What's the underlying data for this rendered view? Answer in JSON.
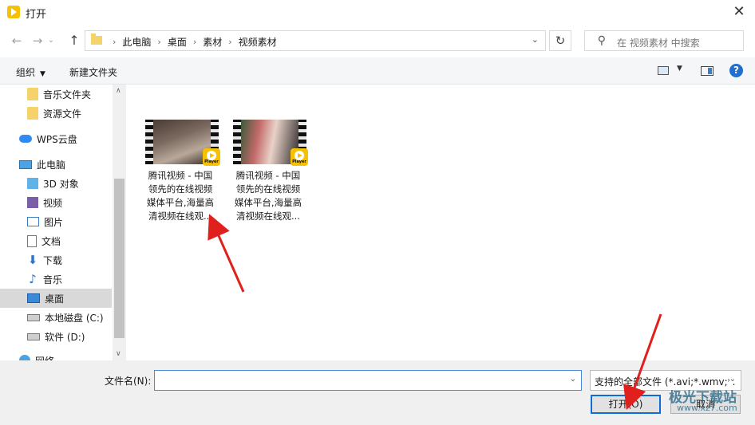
{
  "window": {
    "title": "打开",
    "close_glyph": "✕"
  },
  "nav": {
    "back_glyph": "←",
    "forward_glyph": "→",
    "dropdown_glyph": "⌄",
    "up_glyph": "↑",
    "breadcrumbs": [
      "此电脑",
      "桌面",
      "素材",
      "视频素材"
    ],
    "separator": "›",
    "address_dropdown_glyph": "⌄",
    "refresh_glyph": "↻",
    "search_placeholder": "在 视频素材 中搜索"
  },
  "toolbar": {
    "organize_label": "组织",
    "organize_caret": "▼",
    "new_folder_label": "新建文件夹",
    "view_dd_glyph": "▼",
    "help_glyph": "?"
  },
  "sidebar": {
    "items": [
      {
        "label": "音乐文件夹",
        "icon": "folder-icon"
      },
      {
        "label": "资源文件",
        "icon": "folder-icon"
      },
      {
        "label": "WPS云盘",
        "icon": "cloud-icon"
      },
      {
        "label": "此电脑",
        "icon": "computer-icon"
      },
      {
        "label": "3D 对象",
        "icon": "3d-objects-icon"
      },
      {
        "label": "视频",
        "icon": "videos-icon"
      },
      {
        "label": "图片",
        "icon": "pictures-icon"
      },
      {
        "label": "文档",
        "icon": "documents-icon"
      },
      {
        "label": "下载",
        "icon": "download-icon"
      },
      {
        "label": "音乐",
        "icon": "music-icon"
      },
      {
        "label": "桌面",
        "icon": "desktop-icon",
        "selected": true
      },
      {
        "label": "本地磁盘 (C:)",
        "icon": "drive-icon"
      },
      {
        "label": "软件 (D:)",
        "icon": "drive-icon"
      },
      {
        "label": "网络",
        "icon": "network-icon"
      }
    ],
    "scroll_up_glyph": "∧",
    "scroll_down_glyph": "∨",
    "download_glyph": "⬇",
    "music_glyph": "♪"
  },
  "files": [
    {
      "lines": [
        "腾讯视频 - 中国",
        "领先的在线视频",
        "媒体平台,海量高",
        "清视频在线观..."
      ],
      "badge": "Player"
    },
    {
      "lines": [
        "腾讯视频 - 中国",
        "领先的在线视频",
        "媒体平台,海量高",
        "清视频在线观..."
      ],
      "badge": "Player"
    }
  ],
  "footer": {
    "filename_label": "文件名(N):",
    "filename_value": "",
    "filetype_value": "支持的全部文件 (*.avi;*.wmv;*.",
    "dropdown_glyph": "⌄",
    "open_label": "打开(O)",
    "cancel_label": "取消"
  },
  "watermark": {
    "brand": "极光下载站",
    "url": "www.xz7.com"
  },
  "colors": {
    "accent": "#0f6bd6",
    "annotation_arrow": "#e0201c",
    "player_badge": "#f6c100"
  }
}
